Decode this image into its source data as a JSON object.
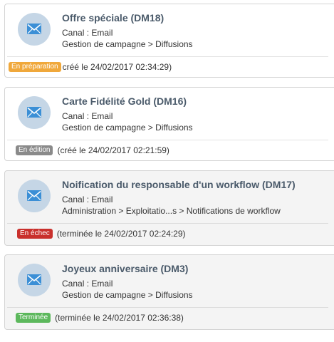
{
  "colors": {
    "preparation": "#f0a83b",
    "editing": "#8a8a8a",
    "failed": "#c9302c",
    "finished": "#5cb85c",
    "avatar": "#c5d6e6",
    "icon": "#3b8fd6"
  },
  "deliveries": [
    {
      "icon": "envelope-icon",
      "title": "Offre spéciale (DM18)",
      "channel": "Canal : Email",
      "path": "Gestion de campagne > Diffusions",
      "status": "En préparation",
      "info": "créé le 24/02/2017 02:34:29)"
    },
    {
      "icon": "envelope-icon",
      "title": "Carte Fidélité Gold (DM16)",
      "channel": "Canal : Email",
      "path": "Gestion de campagne > Diffusions",
      "status": "En édition",
      "info": "(créé le 24/02/2017 02:21:59)"
    },
    {
      "icon": "envelope-icon",
      "title": "Noification du responsable d'un workflow (DM17)",
      "channel": "Canal : Email",
      "path": "Administration > Exploitatio...s > Notifications de workflow",
      "status": "En échec",
      "info": "(terminée le 24/02/2017 02:24:29)"
    },
    {
      "icon": "envelope-icon",
      "title": "Joyeux anniversaire (DM3)",
      "channel": "Canal : Email",
      "path": "Gestion de campagne > Diffusions",
      "status": "Terminée",
      "info": "(terminée le 24/02/2017 02:36:38)"
    }
  ]
}
